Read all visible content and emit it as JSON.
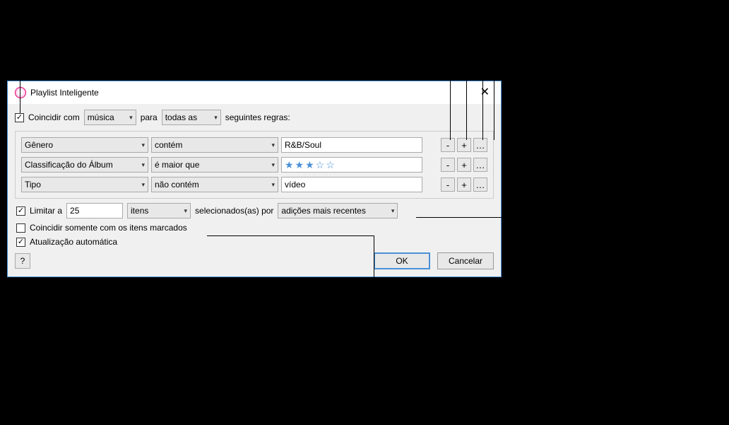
{
  "titlebar": {
    "title": "Playlist Inteligente"
  },
  "match": {
    "checkbox_checked": true,
    "prefix": "Coincidir com",
    "media_select": "música",
    "middle": "para",
    "scope_select": "todas as",
    "suffix": "seguintes regras:"
  },
  "rules": [
    {
      "field": "Gênero",
      "operator": "contém",
      "value_type": "text",
      "value": "R&B/Soul"
    },
    {
      "field": "Classificação do Álbum",
      "operator": "é maior que",
      "value_type": "stars",
      "stars_filled": 3,
      "stars_total": 5
    },
    {
      "field": "Tipo",
      "operator": "não contém",
      "value_type": "text",
      "value": "vídeo"
    }
  ],
  "rowbtns": {
    "remove": "-",
    "add": "+",
    "more": "…"
  },
  "limit": {
    "checked": true,
    "label": "Limitar a",
    "count": "25",
    "unit": "itens",
    "by_label": "selecionados(as) por",
    "by_value": "adições mais recentes"
  },
  "only_checked": {
    "checked": false,
    "label": "Coincidir somente com os itens marcados"
  },
  "live_update": {
    "checked": true,
    "label": "Atualização automática"
  },
  "help_label": "?",
  "ok_label": "OK",
  "cancel_label": "Cancelar"
}
